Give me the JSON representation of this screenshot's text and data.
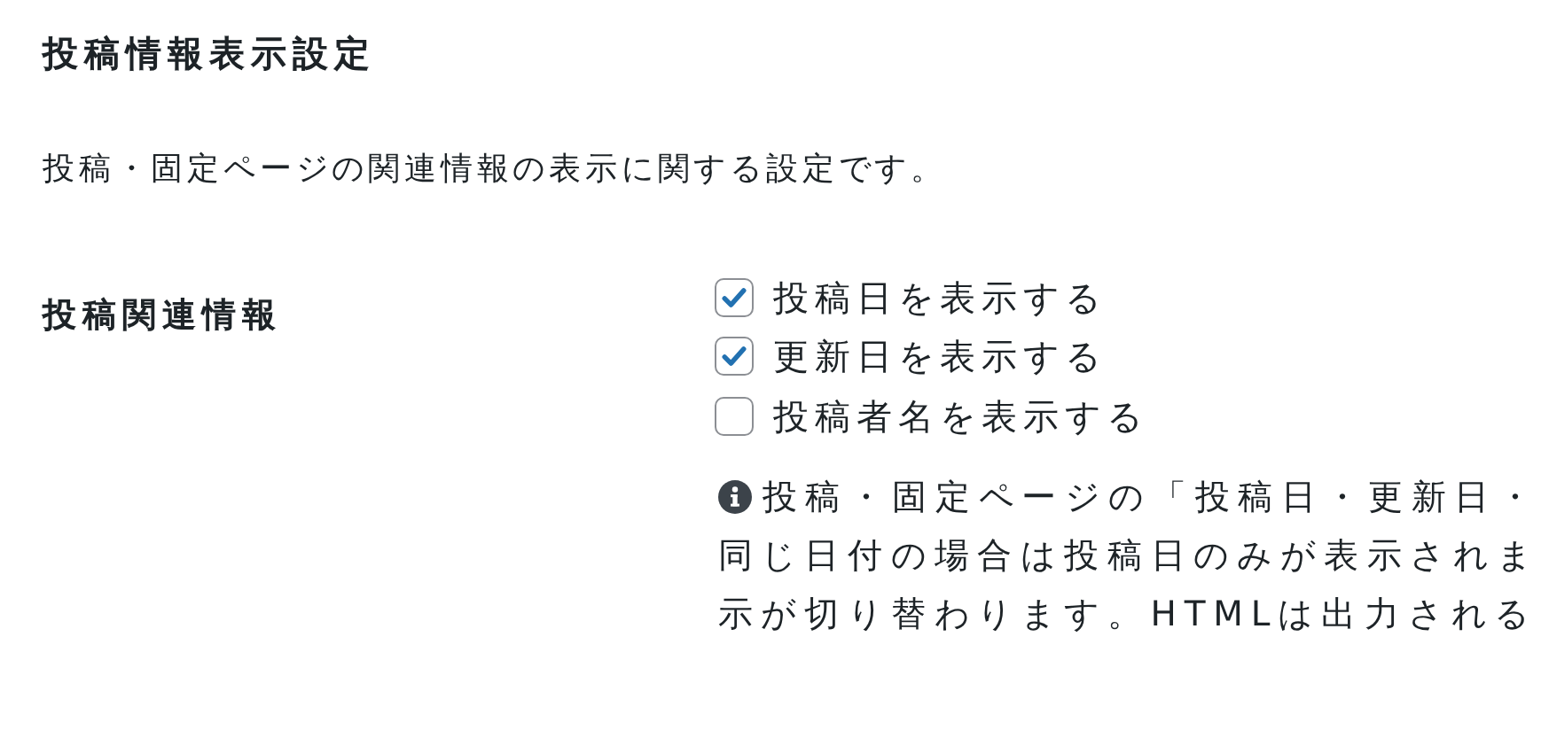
{
  "section_title": "投稿情報表示設定",
  "description": "投稿・固定ページの関連情報の表示に関する設定です。",
  "setting": {
    "label": "投稿関連情報",
    "options": [
      {
        "label": "投稿日を表示する",
        "checked": true
      },
      {
        "label": "更新日を表示する",
        "checked": true
      },
      {
        "label": "投稿者名を表示する",
        "checked": false
      }
    ],
    "note_lines": [
      "投稿・固定ページの「投稿日・更新日・",
      "同じ日付の場合は投稿日のみが表示されま",
      "示が切り替わります。HTMLは出力される"
    ]
  }
}
